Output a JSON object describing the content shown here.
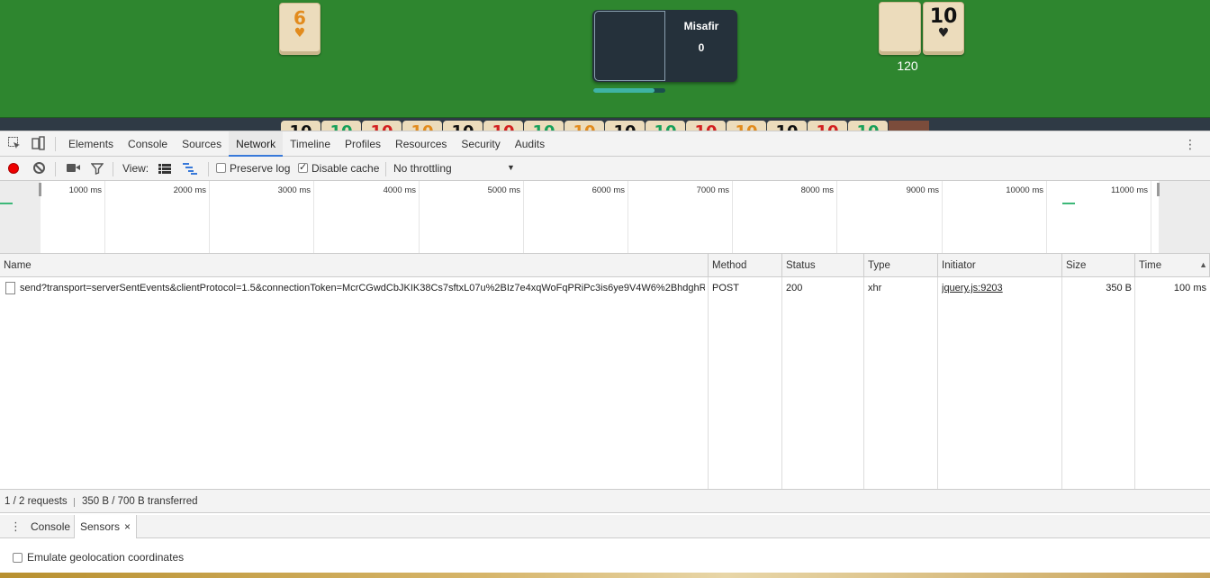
{
  "game": {
    "left_tile": {
      "number": "6",
      "symbol": "♥",
      "color": "#e28b1d"
    },
    "right_tile": {
      "number": "10",
      "symbol": "♥",
      "color": "#111111"
    },
    "right_score": "120",
    "player": {
      "name": "Misafir",
      "score": "0",
      "timer_fraction": 0.85
    },
    "rack": [
      {
        "number": "10",
        "color": "#111111"
      },
      {
        "number": "10",
        "color": "#18a05a"
      },
      {
        "number": "10",
        "color": "#d32020"
      },
      {
        "number": "10",
        "color": "#e28b1d"
      },
      {
        "number": "10",
        "color": "#111111"
      },
      {
        "number": "10",
        "color": "#d32020"
      },
      {
        "number": "10",
        "color": "#18a05a"
      },
      {
        "number": "10",
        "color": "#e28b1d"
      },
      {
        "number": "10",
        "color": "#111111"
      },
      {
        "number": "10",
        "color": "#18a05a"
      },
      {
        "number": "10",
        "color": "#d32020"
      },
      {
        "number": "10",
        "color": "#e28b1d"
      },
      {
        "number": "10",
        "color": "#111111"
      },
      {
        "number": "10",
        "color": "#d32020"
      },
      {
        "number": "10",
        "color": "#18a05a"
      }
    ]
  },
  "devtools": {
    "tabs": [
      "Elements",
      "Console",
      "Sources",
      "Network",
      "Timeline",
      "Profiles",
      "Resources",
      "Security",
      "Audits"
    ],
    "active_tab": "Network",
    "toolbar": {
      "view_label": "View:",
      "preserve_log": {
        "label": "Preserve log",
        "checked": false
      },
      "disable_cache": {
        "label": "Disable cache",
        "checked": true
      },
      "throttling": "No throttling"
    },
    "overview_ticks": [
      "1000 ms",
      "2000 ms",
      "3000 ms",
      "4000 ms",
      "5000 ms",
      "6000 ms",
      "7000 ms",
      "8000 ms",
      "9000 ms",
      "10000 ms",
      "11000 ms"
    ],
    "columns": [
      "Name",
      "Method",
      "Status",
      "Type",
      "Initiator",
      "Size",
      "Time"
    ],
    "rows": [
      {
        "name": "send?transport=serverSentEvents&clientProtocol=1.5&connectionToken=McrCGwdCbJKIK38Cs7sftxL07u%2BIz7e4xqWoFqPRiPc3is6ye9V4W6%2BhdghReX...",
        "method": "POST",
        "status": "200",
        "type": "xhr",
        "initiator": "jquery.js:9203",
        "size": "350 B",
        "time": "100 ms"
      }
    ],
    "status": {
      "requests": "1 / 2 requests",
      "transferred": "350 B / 700 B transferred"
    },
    "drawer": {
      "tabs": [
        "Console",
        "Sensors"
      ],
      "active_tab": "Sensors",
      "geolocation_label": "Emulate geolocation coordinates"
    }
  }
}
